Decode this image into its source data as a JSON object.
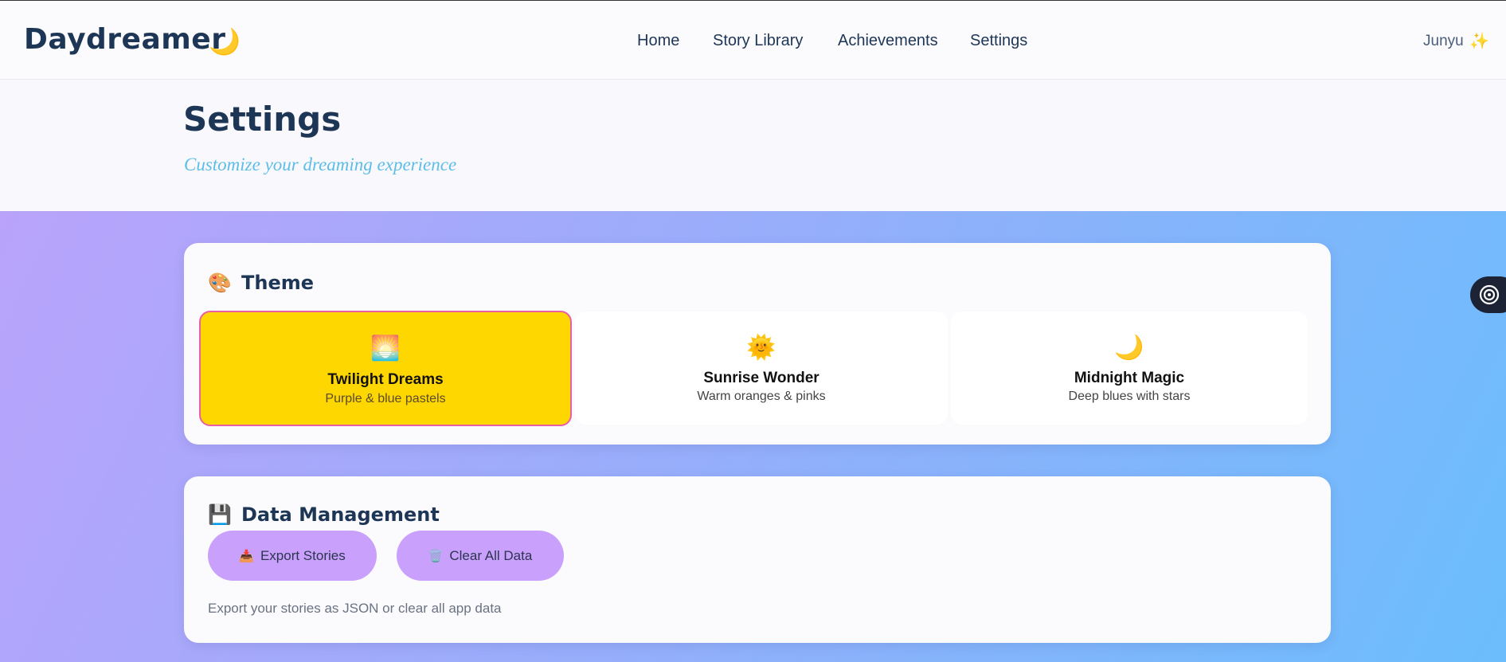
{
  "app": {
    "logo": "Daydreamer",
    "logo_icon": "🌙",
    "nav": [
      "Home",
      "Story Library",
      "Achievements",
      "Settings"
    ],
    "user_name": "Junyu",
    "user_icon": "✨"
  },
  "header": {
    "title": "Settings",
    "subtitle": "Customize your dreaming experience"
  },
  "theme_section": {
    "icon": "🎨",
    "title": "Theme",
    "options": [
      {
        "icon": "🌅",
        "name": "Twilight Dreams",
        "desc": "Purple & blue pastels",
        "selected": true
      },
      {
        "icon": "🌞",
        "name": "Sunrise Wonder",
        "desc": "Warm oranges & pinks",
        "selected": false
      },
      {
        "icon": "🌙",
        "name": "Midnight Magic",
        "desc": "Deep blues with stars",
        "selected": false
      }
    ]
  },
  "data_section": {
    "icon": "💾",
    "title": "Data Management",
    "export_icon": "📥",
    "export_label": "Export Stories",
    "clear_icon": "🗑️",
    "clear_label": "Clear All Data",
    "note": "Export your stories as JSON or clear all app data"
  },
  "colors": {
    "brand_text": "#1e3656",
    "subtitle": "#5cbde6",
    "selected_theme_bg": "#ffd700",
    "selected_theme_border": "#e95fa6",
    "button_bg": "#c9a0fc",
    "gradient_start": "#b9a3fb",
    "gradient_end": "#6bbdfc"
  }
}
